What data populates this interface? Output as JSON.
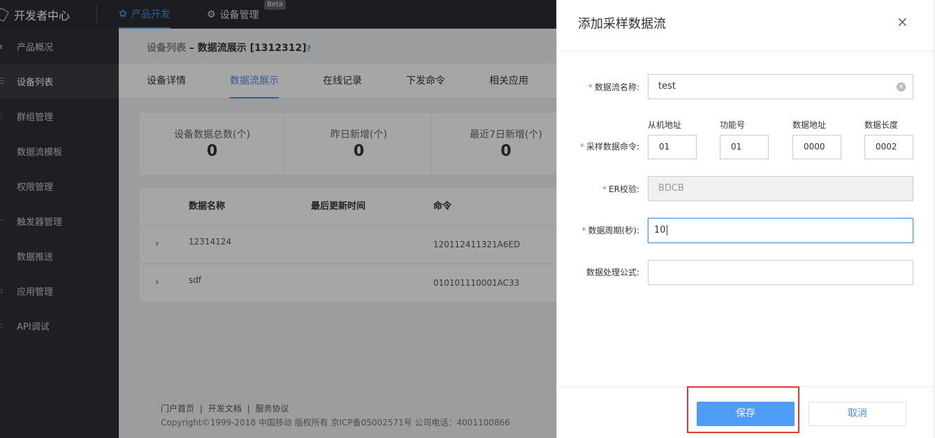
{
  "topbar": {
    "brand": "开发者中心",
    "nav": [
      {
        "label": "产品开发",
        "icon": "cluster-icon"
      },
      {
        "label": "设备管理",
        "icon": "gear-icon"
      }
    ],
    "beta_badge": "Beta"
  },
  "sidebar": {
    "items": [
      {
        "label": "产品概况"
      },
      {
        "label": "设备列表"
      },
      {
        "label": "群组管理"
      },
      {
        "label": "数据流模板"
      },
      {
        "label": "权限管理"
      },
      {
        "label": "触发器管理"
      },
      {
        "label": "数据推送"
      },
      {
        "label": "应用管理"
      },
      {
        "label": "API调试"
      }
    ],
    "active_index": 1
  },
  "main": {
    "breadcrumb": {
      "part1": "设备列表",
      "sep": " – ",
      "part2": "数据流展示 [1312312]",
      "help": "?"
    },
    "tabs": [
      "设备详情",
      "数据流展示",
      "在线记录",
      "下发命令",
      "相关应用"
    ],
    "active_tab": 1,
    "stats": [
      {
        "label": "设备数据总数(个)",
        "value": "0"
      },
      {
        "label": "昨日新增(个)",
        "value": "0"
      },
      {
        "label": "最近7日新增(个)",
        "value": "0"
      }
    ],
    "table": {
      "headers": [
        "数据名称",
        "最后更新时间",
        "命令"
      ],
      "rows": [
        {
          "name": "12314124",
          "updated": "",
          "command": "120112411321A6ED"
        },
        {
          "name": "sdf",
          "updated": "",
          "command": "010101110001AC33"
        }
      ]
    },
    "footer": {
      "links": [
        "门户首页",
        "|",
        "开发文档",
        "|",
        "服务协议"
      ],
      "copyright": "Copyright©1999-2018 中国移动 版权所有 京ICP备05002571号 公司电话：4001100866"
    }
  },
  "drawer": {
    "title": "添加采样数据流",
    "close": "×",
    "fields": {
      "name_label": "数据流名称:",
      "name_value": "test",
      "cmd_label": "采样数据命令:",
      "cmd_sublabels": [
        "从机地址",
        "功能号",
        "数据地址",
        "数据长度"
      ],
      "cmd_values": [
        "01",
        "01",
        "0000",
        "0002"
      ],
      "er_label": "ER校验:",
      "er_value": "BDCB",
      "period_label": "数据周期(秒):",
      "period_value": "10",
      "formula_label": "数据处理公式:",
      "formula_value": ""
    },
    "required_mark": "*",
    "save_label": "保存",
    "cancel_label": "取消"
  }
}
